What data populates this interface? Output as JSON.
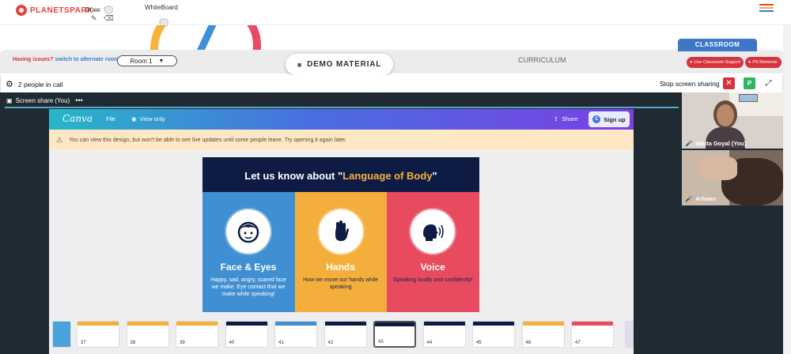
{
  "header": {
    "logo_text": "PLANETSPARK",
    "draw_label": "Draw",
    "whiteboard_label": "WhiteBoard"
  },
  "controls": {
    "issues_prefix": "Having issues?",
    "issues_link": "switch to alternate room",
    "room_selected": "Room 1",
    "demo_material": "DEMO MATERIAL",
    "curriculum": "CURRICULUM",
    "classroom_tab": "CLASSROOM",
    "live_support": "Live Classroom Support",
    "ps_moments": "PS Moments"
  },
  "call": {
    "people_count": "2 people in call",
    "stop_sharing": "Stop screen sharing",
    "avatar_letter": "P",
    "share_title": "Screen share (You)"
  },
  "canva": {
    "logo": "Canva",
    "file": "File",
    "view_only": "View only",
    "share": "Share",
    "sign_up": "Sign up",
    "warning": "You can view this design, but won't be able to see live updates until some people leave. Try opening it again later."
  },
  "slide": {
    "title_prefix": "Let us know about \"",
    "title_highlight": "Language of Body",
    "title_suffix": "\"",
    "columns": [
      {
        "heading": "Face & Eyes",
        "text": "Happy, sad, angry, scared face we make. Eye contact that we make while speaking!",
        "color": "#3f8fd2",
        "text_color": "#ffffff"
      },
      {
        "heading": "Hands",
        "text": "How we move our hands while speaking",
        "color": "#f4ae3c",
        "text_color": "#1b2247"
      },
      {
        "heading": "Voice",
        "text": "Speaking loudly and confidently!",
        "color": "#e84a5f",
        "text_color": "#1b2247"
      }
    ]
  },
  "thumbnails": {
    "numbers": [
      "37",
      "38",
      "39",
      "40",
      "41",
      "42",
      "43",
      "44",
      "45",
      "46",
      "47"
    ],
    "active": "43"
  },
  "participants": [
    {
      "name": "Nikita Goyal (You)"
    },
    {
      "name": "Arhaan"
    }
  ],
  "colors": {
    "brand_red": "#d6333d",
    "accent_blue": "#3d78c8",
    "green": "#2db65b",
    "dark_bg": "#1f2a33"
  }
}
